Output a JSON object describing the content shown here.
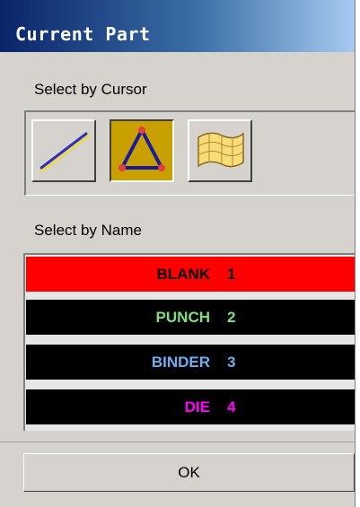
{
  "window": {
    "title": "Current Part"
  },
  "cursor_section": {
    "label": "Select by Cursor",
    "tools": [
      {
        "name": "line-tool",
        "icon": "line-icon",
        "active": false
      },
      {
        "name": "triangle-element-tool",
        "icon": "triangle-nodes-icon",
        "active": true
      },
      {
        "name": "surface-tool",
        "icon": "mesh-surface-icon",
        "active": false
      }
    ]
  },
  "name_section": {
    "label": "Select by Name",
    "parts": [
      {
        "name": "BLANK",
        "number": "1",
        "bg": "#ff0000",
        "fg": "#000000",
        "num_fg": "#000000"
      },
      {
        "name": "PUNCH",
        "number": "2",
        "bg": "#000000",
        "fg": "#80e080",
        "num_fg": "#80e080"
      },
      {
        "name": "BINDER",
        "number": "3",
        "bg": "#000000",
        "fg": "#6ab0f0",
        "num_fg": "#6ab0f0"
      },
      {
        "name": "DIE",
        "number": "4",
        "bg": "#000000",
        "fg": "#ff00ff",
        "num_fg": "#ff00ff"
      }
    ]
  },
  "ok_label": "OK"
}
